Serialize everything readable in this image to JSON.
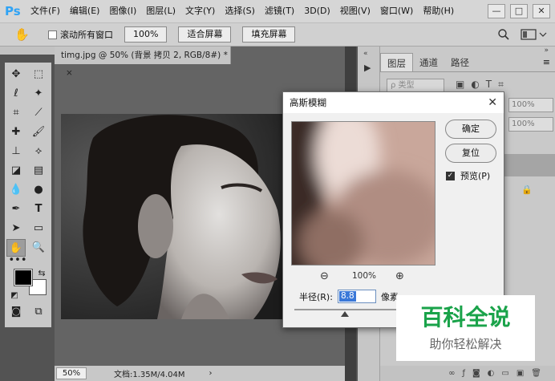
{
  "app": {
    "logo": "Ps"
  },
  "menu": [
    "文件(F)",
    "编辑(E)",
    "图像(I)",
    "图层(L)",
    "文字(Y)",
    "选择(S)",
    "滤镜(T)",
    "3D(D)",
    "视图(V)",
    "窗口(W)",
    "帮助(H)"
  ],
  "window_controls": {
    "minimize": "—",
    "restore": "□",
    "close": "✕"
  },
  "options": {
    "scroll_all_windows": "滚动所有窗口",
    "zoom_100": "100%",
    "fit_screen": "适合屏幕",
    "fill_screen": "填充屏幕"
  },
  "document": {
    "tab_title": "timg.jpg @ 50% (背景 拷贝 2, RGB/8#) *",
    "tab_close": "×",
    "status_zoom": "50%",
    "status_info": "文档:1.35M/4.04M",
    "status_arrow": "›"
  },
  "panel": {
    "tabs": [
      "图层",
      "通道",
      "路径"
    ],
    "kind_filter": "ρ 类型",
    "opacity_1": "100%",
    "opacity_2": "100%"
  },
  "dialog": {
    "title": "高斯模糊",
    "close": "✕",
    "ok": "确定",
    "reset": "复位",
    "preview_label": "预览(P)",
    "preview_checked": "✓",
    "zoom_out": "⊖",
    "zoom_in": "⊕",
    "zoom_level": "100%",
    "radius_label": "半径(R):",
    "radius_value": "8.8",
    "radius_unit": "像素"
  },
  "watermark": {
    "line1": "百科全说",
    "line2": "助你轻松解决"
  },
  "colors": {
    "accent": "#2fa3f5",
    "watermark_green": "#1aa34a"
  }
}
